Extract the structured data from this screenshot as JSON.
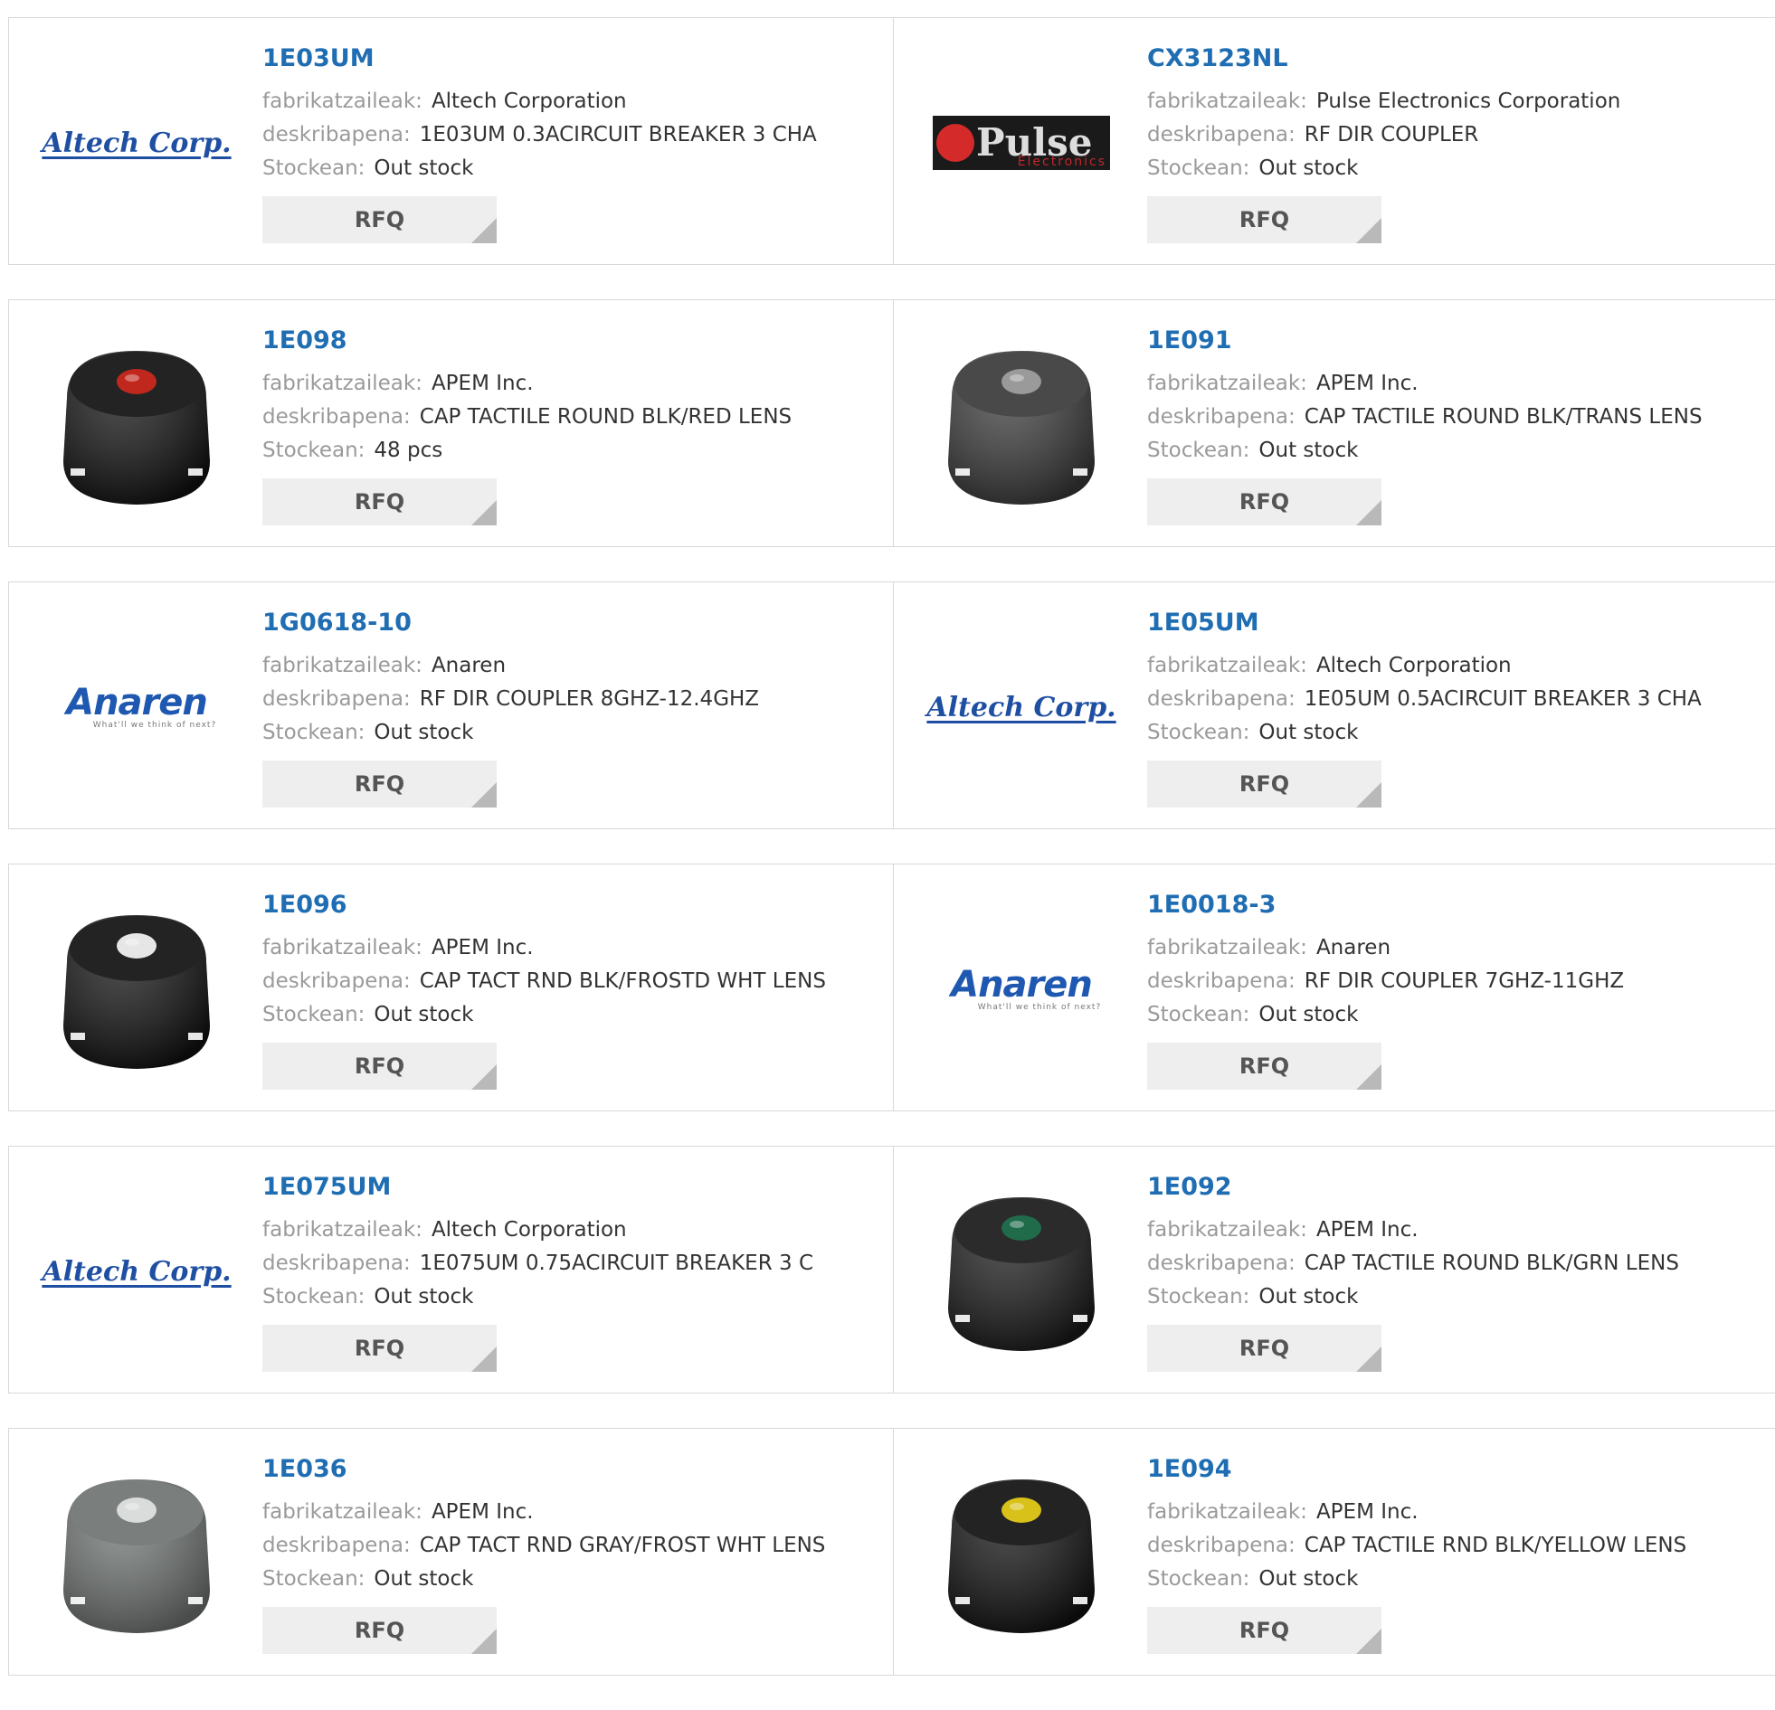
{
  "labels": {
    "manufacturer": "fabrikatzaileak:",
    "description": "deskribapena:",
    "stock": "Stockean:",
    "rfq": "RFQ"
  },
  "logos": {
    "altech": "Altech Corp.",
    "anaren": "Anaren",
    "anaren_tagline": "What'll we think of next?",
    "pulse": "Pulse",
    "pulse_sub": "Electronics"
  },
  "products": [
    {
      "part": "1E03UM",
      "manufacturer": "Altech Corporation",
      "description": "1E03UM 0.3ACIRCUIT BREAKER 3 CHA",
      "stock": "Out stock",
      "image": "altech-logo"
    },
    {
      "part": "CX3123NL",
      "manufacturer": "Pulse Electronics Corporation",
      "description": "RF DIR COUPLER",
      "stock": "Out stock",
      "image": "pulse-logo"
    },
    {
      "part": "1E098",
      "manufacturer": "APEM Inc.",
      "description": "CAP TACTILE ROUND BLK/RED LENS",
      "stock": "48 pcs",
      "image": "cap-icon",
      "cap_color": "#111111",
      "lens_color": "#c0281d"
    },
    {
      "part": "1E091",
      "manufacturer": "APEM Inc.",
      "description": "CAP TACTILE ROUND BLK/TRANS LENS",
      "stock": "Out stock",
      "image": "cap-icon",
      "cap_color": "#3a3a3a",
      "lens_color": "#9a9a9a"
    },
    {
      "part": "1G0618-10",
      "manufacturer": "Anaren",
      "description": "RF DIR COUPLER 8GHZ-12.4GHZ",
      "stock": "Out stock",
      "image": "anaren-logo"
    },
    {
      "part": "1E05UM",
      "manufacturer": "Altech Corporation",
      "description": "1E05UM 0.5ACIRCUIT BREAKER 3 CHA",
      "stock": "Out stock",
      "image": "altech-logo"
    },
    {
      "part": "1E096",
      "manufacturer": "APEM Inc.",
      "description": "CAP TACT RND BLK/FROSTD WHT LENS",
      "stock": "Out stock",
      "image": "cap-icon",
      "cap_color": "#111111",
      "lens_color": "#e6e6e6"
    },
    {
      "part": "1E0018-3",
      "manufacturer": "Anaren",
      "description": "RF DIR COUPLER 7GHZ-11GHZ",
      "stock": "Out stock",
      "image": "anaren-logo"
    },
    {
      "part": "1E075UM",
      "manufacturer": "Altech Corporation",
      "description": "1E075UM 0.75ACIRCUIT BREAKER 3 C",
      "stock": "Out stock",
      "image": "altech-logo"
    },
    {
      "part": "1E092",
      "manufacturer": "APEM Inc.",
      "description": "CAP TACTILE ROUND BLK/GRN LENS",
      "stock": "Out stock",
      "image": "cap-icon",
      "cap_color": "#1a1a1a",
      "lens_color": "#1f6b4a"
    },
    {
      "part": "1E036",
      "manufacturer": "APEM Inc.",
      "description": "CAP TACT RND GRAY/FROST WHT LENS",
      "stock": "Out stock",
      "image": "cap-icon",
      "cap_color": "#6f7472",
      "lens_color": "#d9dcdb"
    },
    {
      "part": "1E094",
      "manufacturer": "APEM Inc.",
      "description": "CAP TACTILE RND BLK/YELLOW LENS",
      "stock": "Out stock",
      "image": "cap-icon",
      "cap_color": "#111111",
      "lens_color": "#d8c21a"
    }
  ]
}
